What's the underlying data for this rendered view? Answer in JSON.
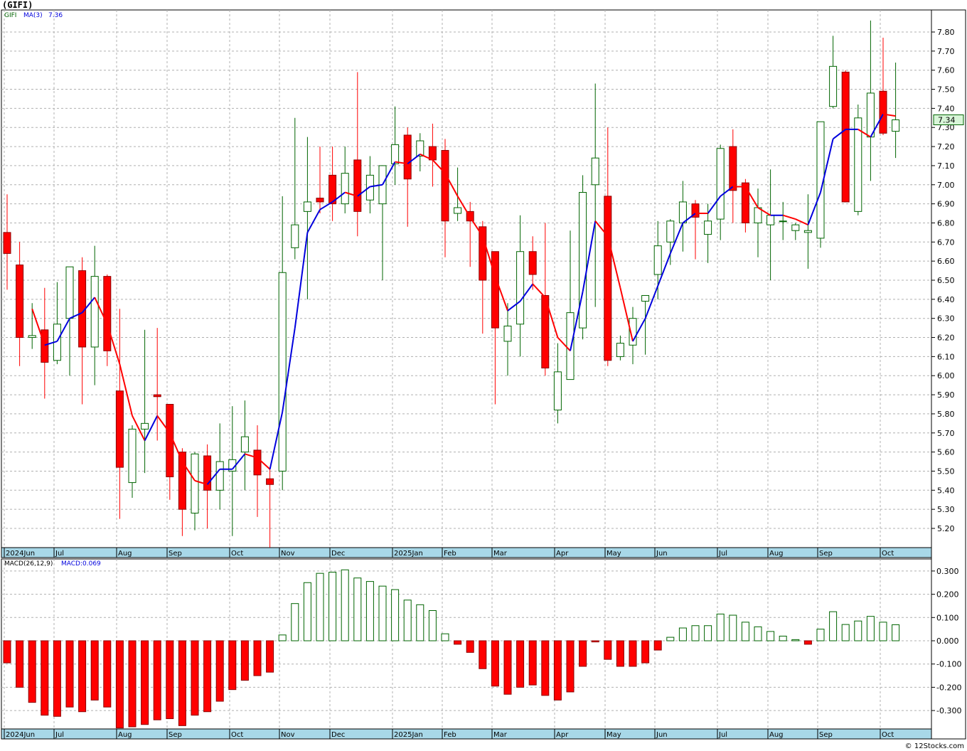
{
  "title": "(GIFI)",
  "credit": "© 12Stocks.com",
  "chart_data": [
    {
      "type": "candlestick",
      "symbol": "GIFI",
      "legend": {
        "symbol": "GIFI",
        "ma_label": "MA(3)",
        "ma_value": "7.36"
      },
      "last_price": "7.34",
      "ylim": [
        5.1,
        7.9
      ],
      "yticks": [
        "5.20",
        "5.30",
        "5.40",
        "5.50",
        "5.60",
        "5.70",
        "5.80",
        "5.90",
        "6.00",
        "6.10",
        "6.20",
        "6.30",
        "6.40",
        "6.50",
        "6.60",
        "6.70",
        "6.80",
        "6.90",
        "7.00",
        "7.10",
        "7.20",
        "7.30",
        "7.40",
        "7.50",
        "7.60",
        "7.70",
        "7.80"
      ],
      "month_labels": [
        {
          "label": "2024Jun",
          "bar": 0
        },
        {
          "label": "Jul",
          "bar": 4
        },
        {
          "label": "Aug",
          "bar": 9
        },
        {
          "label": "Sep",
          "bar": 13
        },
        {
          "label": "Oct",
          "bar": 18
        },
        {
          "label": "Nov",
          "bar": 22
        },
        {
          "label": "Dec",
          "bar": 26
        },
        {
          "label": "2025Jan",
          "bar": 31
        },
        {
          "label": "Feb",
          "bar": 35
        },
        {
          "label": "Mar",
          "bar": 39
        },
        {
          "label": "Apr",
          "bar": 44
        },
        {
          "label": "May",
          "bar": 48
        },
        {
          "label": "Jun",
          "bar": 52
        },
        {
          "label": "Jul",
          "bar": 57
        },
        {
          "label": "Aug",
          "bar": 61
        },
        {
          "label": "Sep",
          "bar": 65
        },
        {
          "label": "Oct",
          "bar": 70
        }
      ],
      "colors": {
        "up": "#006400",
        "down": "#ff0000",
        "ma_up": "#0000dd",
        "ma_down": "#ff0000",
        "grid": "#b0b0b0",
        "axis_bar": "#a8d8e8"
      },
      "ohlc": [
        [
          6.75,
          6.95,
          6.45,
          6.64
        ],
        [
          6.58,
          6.7,
          6.05,
          6.2
        ],
        [
          6.2,
          6.38,
          6.14,
          6.21
        ],
        [
          6.24,
          6.46,
          5.88,
          6.07
        ],
        [
          6.08,
          6.49,
          6.06,
          6.27
        ],
        [
          6.3,
          6.57,
          6.0,
          6.57
        ],
        [
          6.55,
          6.62,
          5.85,
          6.15
        ],
        [
          6.15,
          6.68,
          5.95,
          6.52
        ],
        [
          6.52,
          6.53,
          6.05,
          6.13
        ],
        [
          5.92,
          6.35,
          5.25,
          5.52
        ],
        [
          5.44,
          5.74,
          5.36,
          5.72
        ],
        [
          5.72,
          6.24,
          5.49,
          5.75
        ],
        [
          5.9,
          6.25,
          5.66,
          5.89
        ],
        [
          5.85,
          5.85,
          5.35,
          5.47
        ],
        [
          5.6,
          5.62,
          5.16,
          5.3
        ],
        [
          5.28,
          5.6,
          5.19,
          5.59
        ],
        [
          5.58,
          5.64,
          5.2,
          5.4
        ],
        [
          5.4,
          5.75,
          5.3,
          5.55
        ],
        [
          5.5,
          5.84,
          5.16,
          5.56
        ],
        [
          5.6,
          5.87,
          5.4,
          5.68
        ],
        [
          5.61,
          5.74,
          5.26,
          5.48
        ],
        [
          5.46,
          5.52,
          5.1,
          5.43
        ],
        [
          5.5,
          6.94,
          5.4,
          6.54
        ],
        [
          6.67,
          7.35,
          6.61,
          6.79
        ],
        [
          6.86,
          7.25,
          6.4,
          6.91
        ],
        [
          6.93,
          7.2,
          6.85,
          6.91
        ],
        [
          7.05,
          7.2,
          6.81,
          6.9
        ],
        [
          6.9,
          7.2,
          6.85,
          7.06
        ],
        [
          7.13,
          7.59,
          6.73,
          6.86
        ],
        [
          6.92,
          7.15,
          6.85,
          7.05
        ],
        [
          6.9,
          7.1,
          6.5,
          7.1
        ],
        [
          7.11,
          7.41,
          7.0,
          7.21
        ],
        [
          7.26,
          7.3,
          6.78,
          7.03
        ],
        [
          7.15,
          7.27,
          7.07,
          7.23
        ],
        [
          7.2,
          7.32,
          6.99,
          7.13
        ],
        [
          7.18,
          7.24,
          6.62,
          6.81
        ],
        [
          6.85,
          7.09,
          6.81,
          6.88
        ],
        [
          6.86,
          6.91,
          6.57,
          6.81
        ],
        [
          6.78,
          6.81,
          6.22,
          6.5
        ],
        [
          6.65,
          6.65,
          5.85,
          6.25
        ],
        [
          6.18,
          6.38,
          6.0,
          6.26
        ],
        [
          6.27,
          6.84,
          6.1,
          6.65
        ],
        [
          6.65,
          6.73,
          6.45,
          6.53
        ],
        [
          6.42,
          6.8,
          6.0,
          6.04
        ],
        [
          5.82,
          6.17,
          5.75,
          6.02
        ],
        [
          5.98,
          6.76,
          5.98,
          6.33
        ],
        [
          6.25,
          7.05,
          6.19,
          6.96
        ],
        [
          7.0,
          7.53,
          6.36,
          7.14
        ],
        [
          6.94,
          7.3,
          6.05,
          6.08
        ],
        [
          6.1,
          6.21,
          6.08,
          6.17
        ],
        [
          6.16,
          6.36,
          6.06,
          6.3
        ],
        [
          6.39,
          6.42,
          6.11,
          6.42
        ],
        [
          6.53,
          6.81,
          6.4,
          6.68
        ],
        [
          6.7,
          6.82,
          6.58,
          6.81
        ],
        [
          6.8,
          7.02,
          6.65,
          6.91
        ],
        [
          6.9,
          6.92,
          6.61,
          6.83
        ],
        [
          6.74,
          6.9,
          6.59,
          6.81
        ],
        [
          6.82,
          7.21,
          6.71,
          7.19
        ],
        [
          7.2,
          7.29,
          6.8,
          6.97
        ],
        [
          7.01,
          7.03,
          6.75,
          6.8
        ],
        [
          6.8,
          6.98,
          6.62,
          6.88
        ],
        [
          6.79,
          7.08,
          6.5,
          6.84
        ],
        [
          6.81,
          6.91,
          6.71,
          6.81
        ],
        [
          6.76,
          6.8,
          6.71,
          6.79
        ],
        [
          6.75,
          6.95,
          6.56,
          6.76
        ],
        [
          6.72,
          7.0,
          6.67,
          7.33
        ],
        [
          7.41,
          7.78,
          7.4,
          7.62
        ],
        [
          7.59,
          7.6,
          6.91,
          6.91
        ],
        [
          6.86,
          7.42,
          6.84,
          7.35
        ],
        [
          7.25,
          7.86,
          7.02,
          7.48
        ],
        [
          7.49,
          7.77,
          7.26,
          7.27
        ],
        [
          7.28,
          7.64,
          7.14,
          7.34
        ]
      ],
      "ma3": [
        null,
        null,
        6.35,
        6.16,
        6.18,
        6.3,
        6.33,
        6.41,
        6.27,
        6.06,
        5.79,
        5.66,
        5.79,
        5.7,
        5.55,
        5.45,
        5.43,
        5.51,
        5.51,
        5.59,
        5.57,
        5.51,
        5.81,
        6.25,
        6.75,
        6.87,
        6.91,
        6.96,
        6.94,
        6.99,
        7.0,
        7.12,
        7.11,
        7.16,
        7.13,
        7.06,
        6.94,
        6.83,
        6.73,
        6.52,
        6.34,
        6.39,
        6.48,
        6.41,
        6.2,
        6.13,
        6.44,
        6.81,
        6.73,
        6.46,
        6.18,
        6.3,
        6.47,
        6.64,
        6.8,
        6.85,
        6.85,
        6.94,
        6.99,
        6.99,
        6.88,
        6.84,
        6.84,
        6.82,
        6.79,
        6.96,
        7.24,
        7.29,
        7.29,
        7.25,
        7.37,
        7.36
      ],
      "ma3_dir": [
        "d",
        "d",
        "d",
        "d",
        "u",
        "u",
        "u",
        "u",
        "d",
        "d",
        "d",
        "d",
        "u",
        "d",
        "d",
        "d",
        "d",
        "u",
        "u",
        "u",
        "d",
        "d",
        "u",
        "u",
        "u",
        "u",
        "u",
        "u",
        "d",
        "u",
        "u",
        "u",
        "d",
        "u",
        "d",
        "d",
        "d",
        "d",
        "d",
        "d",
        "d",
        "u",
        "u",
        "d",
        "d",
        "d",
        "u",
        "u",
        "d",
        "d",
        "d",
        "u",
        "u",
        "u",
        "u",
        "u",
        "d",
        "u",
        "u",
        "d",
        "d",
        "d",
        "u",
        "d",
        "d",
        "u",
        "u",
        "u",
        "u",
        "d",
        "u",
        "d"
      ]
    },
    {
      "type": "bar",
      "indicator": "MACD",
      "legend": {
        "label": "MACD(26,12,9)",
        "value_label": "MACD:0.069"
      },
      "ylim": [
        -0.38,
        0.32
      ],
      "yticks": [
        "0.300",
        "0.200",
        "0.100",
        "0.000",
        "-0.100",
        "-0.200",
        "-0.300"
      ],
      "values": [
        -0.095,
        -0.2,
        -0.265,
        -0.32,
        -0.325,
        -0.285,
        -0.305,
        -0.255,
        -0.285,
        -0.375,
        -0.37,
        -0.36,
        -0.34,
        -0.335,
        -0.365,
        -0.32,
        -0.305,
        -0.26,
        -0.21,
        -0.17,
        -0.15,
        -0.135,
        0.025,
        0.16,
        0.25,
        0.29,
        0.295,
        0.305,
        0.27,
        0.255,
        0.235,
        0.22,
        0.175,
        0.155,
        0.13,
        0.03,
        -0.015,
        -0.05,
        -0.12,
        -0.195,
        -0.23,
        -0.2,
        -0.19,
        -0.235,
        -0.255,
        -0.22,
        -0.11,
        -0.005,
        -0.08,
        -0.11,
        -0.11,
        -0.095,
        -0.04,
        0.015,
        0.055,
        0.065,
        0.065,
        0.115,
        0.11,
        0.08,
        0.06,
        0.04,
        0.02,
        0.005,
        -0.015,
        0.05,
        0.125,
        0.07,
        0.085,
        0.105,
        0.08,
        0.069
      ]
    }
  ]
}
